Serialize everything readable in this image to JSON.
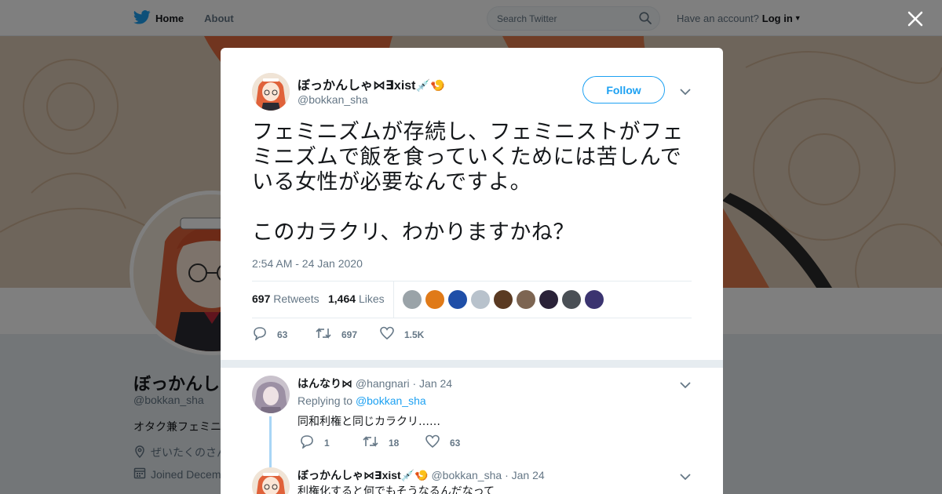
{
  "nav": {
    "home_label": "Home",
    "about_label": "About",
    "search_placeholder": "Search Twitter",
    "have_account": "Have an account?",
    "login_label": "Log in"
  },
  "background_profile": {
    "name": "ぼっかんし",
    "handle": "@bokkan_sha",
    "bio": "オタク兼フェミニ",
    "location": "ぜいたくのさん",
    "joined": "Joined Decem"
  },
  "tweet": {
    "author_name": "ぼっかんしゃ⋈∃xist",
    "author_emoji": "💉🍤",
    "author_handle": "@bokkan_sha",
    "follow_label": "Follow",
    "text_p1": "フェミニズムが存続し、フェミニストがフェミニズムで飯を食っていくためには苦しんでいる女性が必要なんですよ。",
    "text_p2": "このカラクリ、わかりますかね？",
    "timestamp": "2:54 AM - 24 Jan 2020",
    "retweets_count": "697",
    "retweets_label": "Retweets",
    "likes_count": "1,464",
    "likes_label": "Likes",
    "likers_colors": [
      "#9aa3a8",
      "#e07a18",
      "#1f4fa8",
      "#b8c2cc",
      "#5a3a22",
      "#7d6552",
      "#2a2238",
      "#4a4f55",
      "#3b3470"
    ],
    "action_replies": "63",
    "action_retweets": "697",
    "action_likes": "1.5K"
  },
  "replies": [
    {
      "name": "はんなり⋈",
      "handle": "@hangnari",
      "date": "· Jan 24",
      "replying_prefix": "Replying to",
      "replying_to": "@bokkan_sha",
      "text": "同和利権と同じカラクリ……",
      "replies": "1",
      "retweets": "18",
      "likes": "63"
    },
    {
      "name": "ぼっかんしゃ⋈∃xist",
      "emoji": "💉🍤",
      "handle": "@bokkan_sha",
      "date": "· Jan 24",
      "text": "利権化すると何でもそうなるんだなって"
    }
  ]
}
